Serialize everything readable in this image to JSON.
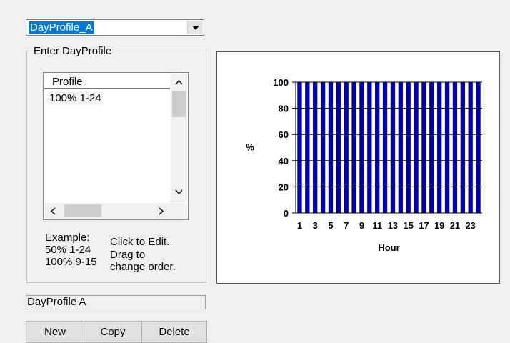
{
  "profile_select": {
    "value": "DayProfile_A"
  },
  "group": {
    "title": "Enter DayProfile",
    "list": {
      "header": "Profile",
      "rows": [
        "100% 1-24"
      ]
    },
    "help": {
      "example_title": "Example:",
      "example_1": "50% 1-24",
      "example_2": "100% 9-15",
      "hint_1": "Click to Edit.",
      "hint_2": "Drag to",
      "hint_3": "change order."
    }
  },
  "name_field": {
    "value": "DayProfile  A"
  },
  "buttons": {
    "new": "New",
    "copy": "Copy",
    "delete": "Delete"
  },
  "icons": {
    "dropdown": "chevron-down-icon",
    "scroll_up": "chevron-up-icon",
    "scroll_down": "chevron-down-icon",
    "scroll_left": "chevron-left-icon",
    "scroll_right": "chevron-right-icon"
  },
  "colors": {
    "bar": "#0000aa",
    "selection": "#0078d7"
  },
  "chart_data": {
    "type": "bar",
    "categories": [
      1,
      2,
      3,
      4,
      5,
      6,
      7,
      8,
      9,
      10,
      11,
      12,
      13,
      14,
      15,
      16,
      17,
      18,
      19,
      20,
      21,
      22,
      23,
      24
    ],
    "values": [
      100,
      100,
      100,
      100,
      100,
      100,
      100,
      100,
      100,
      100,
      100,
      100,
      100,
      100,
      100,
      100,
      100,
      100,
      100,
      100,
      100,
      100,
      100,
      100
    ],
    "xtick_labels": [
      "1",
      "3",
      "5",
      "7",
      "9",
      "11",
      "13",
      "15",
      "17",
      "19",
      "21",
      "23"
    ],
    "yticks": [
      0,
      20,
      40,
      60,
      80,
      100
    ],
    "ylim": [
      0,
      100
    ],
    "xlabel": "Hour",
    "ylabel": "%"
  }
}
